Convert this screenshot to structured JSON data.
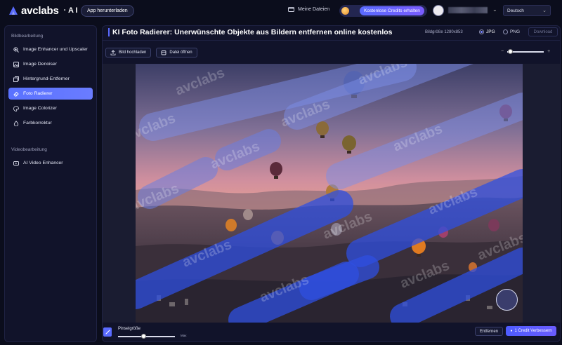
{
  "topbar": {
    "logo_text": "avclabs",
    "logo_suffix": "· A I",
    "download_app_label": "App herunterladen",
    "my_files_label": "Meine Dateien",
    "free_credits_label": "Kostenlose Credits erhalten",
    "language": "Deutsch"
  },
  "sidebar": {
    "image_section": "Bildbearbeitung",
    "image_items": [
      {
        "label": "Image Enhancer und Upscaler",
        "icon": "zoom-in-icon"
      },
      {
        "label": "Image Denoiser",
        "icon": "image-icon"
      },
      {
        "label": "Hintergrund-Entferner",
        "icon": "layers-icon"
      },
      {
        "label": "Foto Radierer",
        "icon": "eraser-icon",
        "active": true
      },
      {
        "label": "Image Colorizer",
        "icon": "palette-icon"
      },
      {
        "label": "Farbkorrektur",
        "icon": "color-drop-icon"
      }
    ],
    "video_section": "Videobearbeitung",
    "video_items": [
      {
        "label": "AI Video Enhancer",
        "icon": "video-enhance-icon"
      }
    ]
  },
  "main": {
    "title": "KI Foto Radierer: Unerwünschte Objekte aus Bildern entfernen online kostenlos",
    "image_size": "Bildgröße 1280x853",
    "format_jpg": "JPG",
    "format_png": "PNG",
    "selected_format": "JPG",
    "download_label": "Download",
    "upload_label": "Bild hochladen",
    "open_file_label": "Datei öffnen",
    "zoom_minus": "−",
    "zoom_plus": "+",
    "zoom_level": 0.05,
    "watermark_text": "avclabs"
  },
  "bottom": {
    "brush_label": "Pinselgröße",
    "brush_max": "Max",
    "brush_size_fraction": 0.42,
    "remove_label": "Entfernen",
    "improve_label": "1 Credit Verbessern"
  },
  "colors": {
    "accent": "#5a6bff",
    "background": "#0b0d1c",
    "panel": "#11132a",
    "mask": "#2f4fe0"
  }
}
